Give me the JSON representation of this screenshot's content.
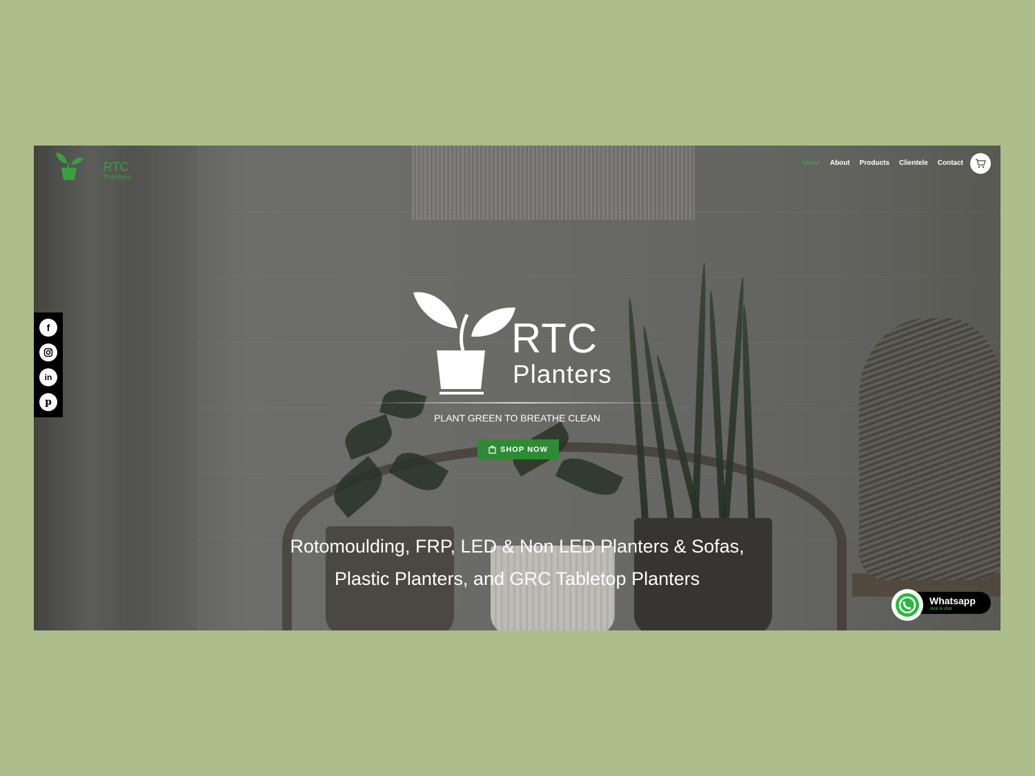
{
  "brand": {
    "name": "RTC",
    "sub": "Planters",
    "color": "#3a9e43"
  },
  "nav": {
    "items": [
      {
        "label": "Home",
        "active": true
      },
      {
        "label": "About"
      },
      {
        "label": "Products"
      },
      {
        "label": "Clientele"
      },
      {
        "label": "Contact"
      }
    ],
    "cart_icon": "cart-icon"
  },
  "social": [
    "facebook-icon",
    "instagram-icon",
    "linkedin-icon",
    "pinterest-icon"
  ],
  "hero": {
    "logo_rtc": "RTC",
    "logo_planters": "Planters",
    "tagline": "PLANT GREEN TO BREATHE CLEAN",
    "cta": "SHOP NOW",
    "headline_line1": "Rotomoulding, FRP, LED & Non LED Planters & Sofas,",
    "headline_line2": "Plastic Planters, and GRC Tabletop Planters"
  },
  "whatsapp": {
    "title": "Whatsapp",
    "sub": "click to chat"
  },
  "colors": {
    "page_bg": "#adbd8b",
    "accent_green": "#2f8a35",
    "active_nav": "#3fae49"
  }
}
